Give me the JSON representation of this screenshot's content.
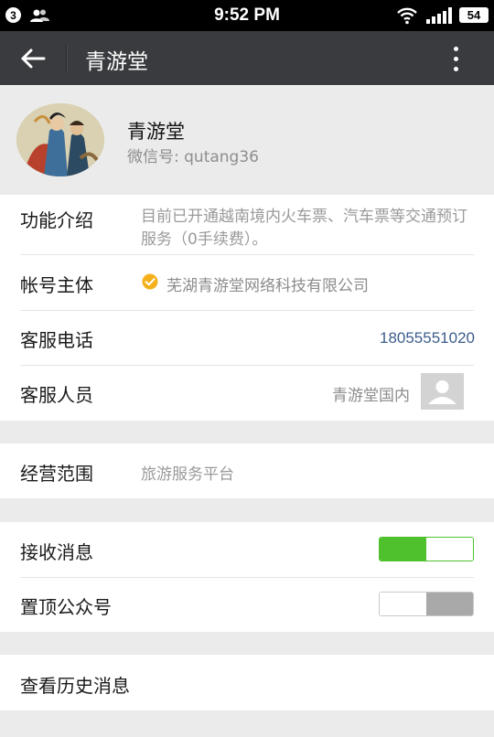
{
  "status_bar": {
    "notification_count": "3",
    "time": "9:52 PM",
    "battery": "54",
    "icons": [
      "people-icon",
      "wifi-icon",
      "signal-icon",
      "battery-icon"
    ]
  },
  "title_bar": {
    "title": "青游堂",
    "back_icon": "back-arrow-icon",
    "menu_icon": "more-vertical-icon"
  },
  "profile": {
    "name": "青游堂",
    "wechat_id": "微信号: qutang36"
  },
  "info": {
    "intro_label": "功能介绍",
    "intro_text": "目前已开通越南境内火车票、汽车票等交通预订服务（0手续费）。",
    "account_label": "帐号主体",
    "account_value": "芜湖青游堂网络科技有限公司",
    "phone_label": "客服电话",
    "phone_value": "18055551020",
    "staff_label": "客服人员",
    "staff_value": "青游堂国内"
  },
  "business": {
    "scope_label": "经营范围",
    "scope_value": "旅游服务平台"
  },
  "settings": {
    "receive_label": "接收消息",
    "receive_on": true,
    "pin_label": "置顶公众号",
    "pin_on": false
  },
  "history": {
    "label": "查看历史消息"
  },
  "colors": {
    "toggle_on": "#4ec12d",
    "title_bar": "#3a3b3f",
    "phone_link": "#3c5d8c",
    "background": "#ebebeb"
  }
}
